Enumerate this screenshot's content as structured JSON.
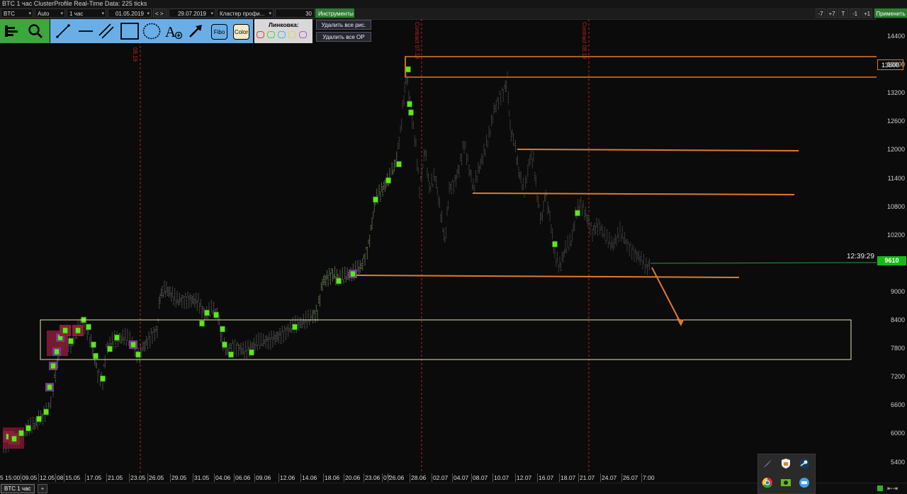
{
  "window": {
    "title": "BTC 1 час ClusterProfile Real-Time Data: 225 ticks"
  },
  "toolbar": {
    "symbol": "BTC",
    "mode": "Auto",
    "timeframe": "1 час",
    "date_from": "01.05.2019",
    "nav_arrows": "< >",
    "date_to": "29.07.2019",
    "chart_type": "Кластер профи...",
    "value": "30",
    "tools_label": "Инструменты",
    "right_buttons": [
      "-7",
      "+7",
      "T",
      "-1",
      "+1"
    ],
    "apply_label": "Применить"
  },
  "drawing_panel": {
    "fibo_label": "Fibo",
    "color_label": "Color",
    "linking_label": "Линковка:",
    "delete_all_drawings": "Удалить все рис.",
    "delete_all_op": "Удалить все ОР",
    "icons": [
      "levels-icon",
      "search-icon",
      "segment-icon",
      "horizontal-line-icon",
      "parallel-lines-icon",
      "rectangle-icon",
      "circle-icon",
      "text-add-icon",
      "arrow-icon"
    ],
    "link_colors": [
      "#e23b3b",
      "#3ddc3d",
      "#3fb6e6",
      "#e6d43f",
      "#c04fe0"
    ]
  },
  "chart": {
    "contract_labels": [
      "09.19",
      "Contract 07.19",
      "Contract 08.19"
    ],
    "y_axis": [
      "14400",
      "13800",
      "13200",
      "12600",
      "12000",
      "11400",
      "10800",
      "10200",
      "9600",
      "9000",
      "8400",
      "7800",
      "7200",
      "6600",
      "6000",
      "5400"
    ],
    "x_axis": [
      "5 15:00",
      "09.05",
      "12.05",
      "08",
      "15.05",
      "17.05",
      "21.05",
      "23.05",
      "26.05",
      "29.05",
      "31.05",
      "04.06",
      "06.06",
      "09.06",
      "12.06",
      "14.06",
      "18.06",
      "20.06",
      "23.06",
      "07",
      "26.06",
      "28.06",
      "02.07",
      "04.07",
      "08.07",
      "10.07",
      "12.07",
      "16.07",
      "18.07",
      "21.07",
      "24.07",
      "26.07",
      "7:00"
    ],
    "time_label": "12:39:29",
    "last_price": "9610",
    "highlight_level": "13800",
    "colors": {
      "level_lines": "#e07a2a",
      "range_box": "#e8e0b0",
      "contract_lines": "#c0201e",
      "price_badge": "#16b816"
    }
  },
  "bottom": {
    "tab_label": "BTC 1 час",
    "add_tab": "+",
    "tray_icons": [
      "feather-icon",
      "shield-icon",
      "steam-icon",
      "chrome-icon",
      "nvidia-icon",
      "messenger-icon"
    ]
  }
}
